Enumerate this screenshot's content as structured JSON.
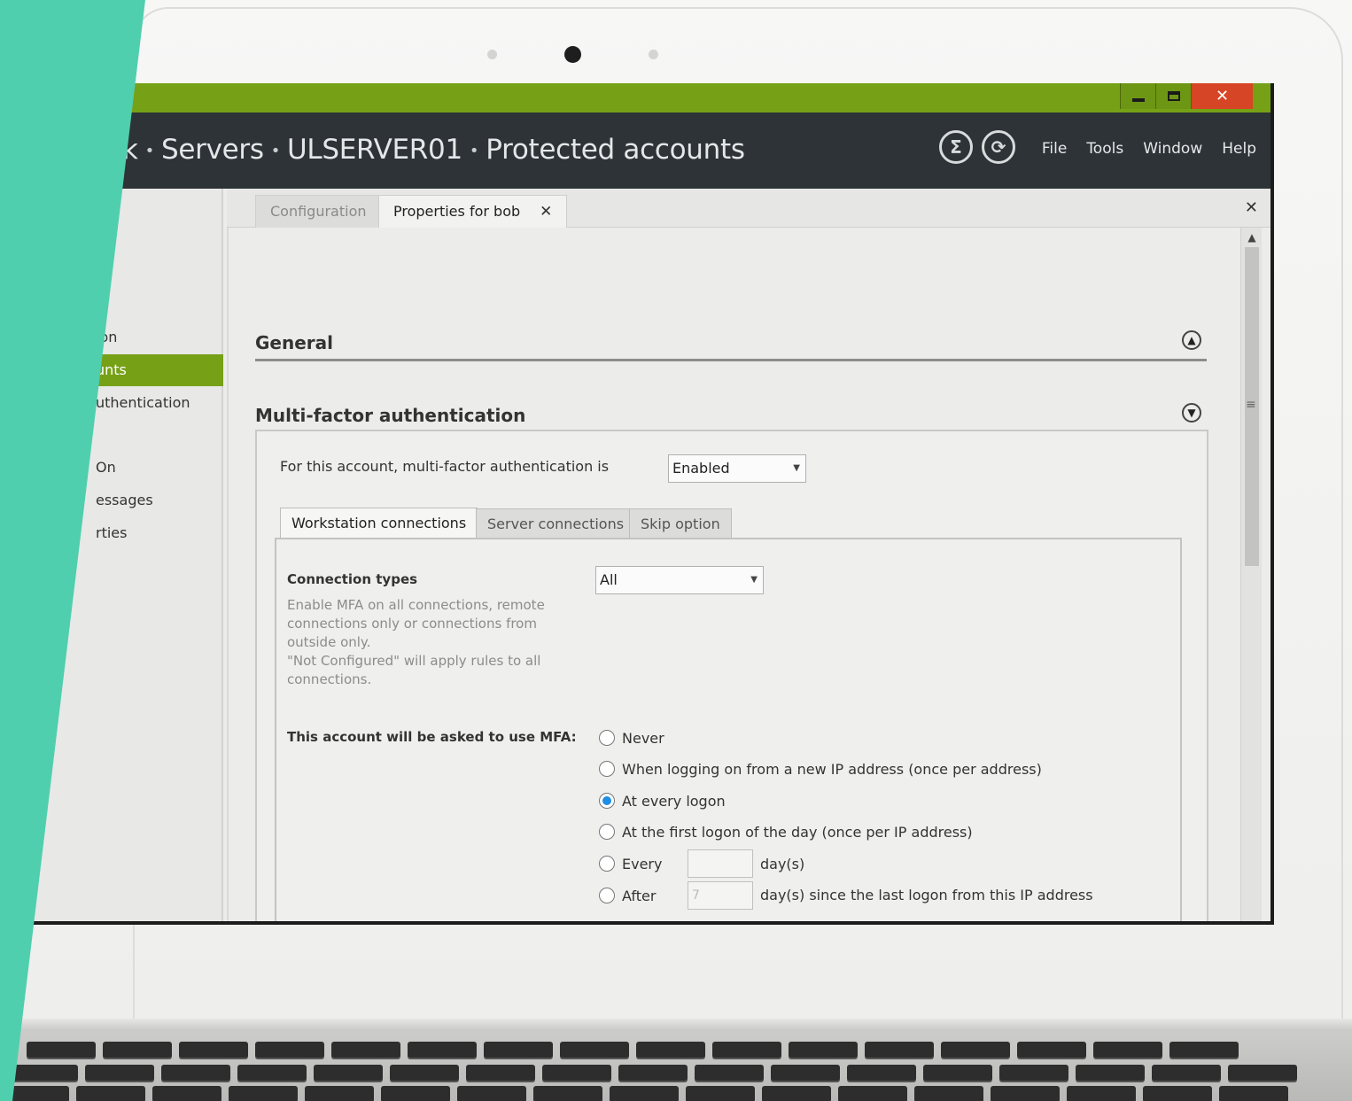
{
  "window": {
    "minimize_glyph": "",
    "maximize_glyph": "",
    "close_glyph": "✕"
  },
  "header": {
    "breadcrumb": [
      "k",
      "Servers",
      "ULSERVER01",
      "Protected accounts"
    ],
    "separator": "•",
    "icons": [
      "sum-icon",
      "refresh-icon"
    ],
    "menu": [
      "File",
      "Tools",
      "Window",
      "Help"
    ]
  },
  "sidebar": {
    "items": [
      {
        "label": "ion",
        "active": false
      },
      {
        "label": "unts",
        "active": true
      },
      {
        "label": "uthentication",
        "active": false
      },
      {
        "label": "On",
        "active": false
      },
      {
        "label": "essages",
        "active": false
      },
      {
        "label": "rties",
        "active": false
      }
    ]
  },
  "doc_tabs": [
    {
      "label": "Configuration",
      "active": false
    },
    {
      "label": "Properties for bob",
      "active": true,
      "close": "✕"
    }
  ],
  "panel_close": "✕",
  "sections": {
    "general": {
      "title": "General"
    },
    "mfa": {
      "title": "Multi-factor authentication",
      "status_label": "For this account, multi-factor authentication is",
      "status_value": "Enabled",
      "tabs": [
        "Workstation connections",
        "Server connections",
        "Skip option"
      ],
      "active_tab": "Workstation connections",
      "connection_types": {
        "label": "Connection types",
        "value": "All",
        "description": [
          "Enable MFA on all connections, remote",
          "connections only or connections from",
          "outside only.",
          "\"Not Configured\" will apply rules to all",
          "connections."
        ]
      },
      "ask_label": "This account will be asked to use MFA:",
      "options": [
        {
          "label": "Never",
          "checked": false
        },
        {
          "label": "When logging on from a new IP address (once per address)",
          "checked": false
        },
        {
          "label": "At every logon",
          "checked": true
        },
        {
          "label": "At the first logon of the day (once per IP address)",
          "checked": false
        },
        {
          "label": "Every",
          "checked": false,
          "input": "",
          "suffix": "day(s)"
        },
        {
          "label": "After",
          "checked": false,
          "input": "7",
          "suffix": "day(s) since the last logon from this IP address"
        }
      ]
    }
  },
  "colors": {
    "accent_green": "#76a117",
    "header_dark": "#2d3336",
    "close_red": "#d64525",
    "teal": "#4fcfae",
    "radio_blue": "#1f8ee6"
  }
}
